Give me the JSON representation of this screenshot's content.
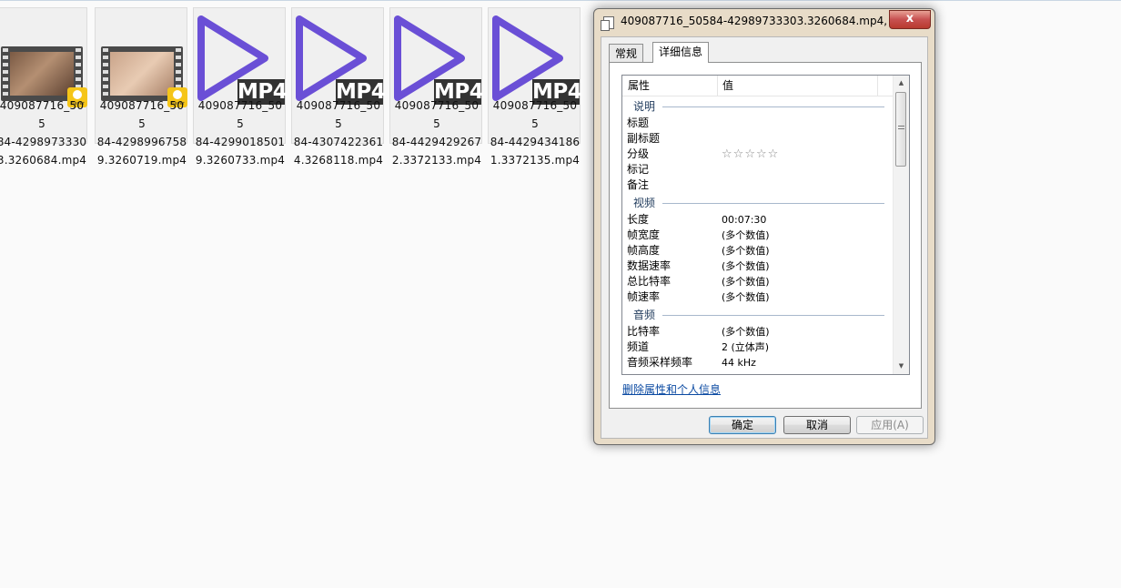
{
  "files": [
    {
      "name": "409087716_50584-42989733303.3260684.mp4",
      "line1": "409087716_505",
      "line2": "84-4298973330",
      "line3": "3.3260684.mp4",
      "thumb": "video-frame",
      "badge": "Player"
    },
    {
      "name": "409087716_50584-42989967589.3260719.mp4",
      "line1": "409087716_505",
      "line2": "84-4298996758",
      "line3": "9.3260719.mp4",
      "thumb": "video-frame",
      "badge": "Player"
    },
    {
      "name": "409087716_50584-42990185019.3260733.mp4",
      "line1": "409087716_505",
      "line2": "84-4299018501",
      "line3": "9.3260733.mp4",
      "thumb": "mp4-play-icon",
      "label": "MP4"
    },
    {
      "name": "409087716_50584-43074223614.3268118.mp4",
      "line1": "409087716_505",
      "line2": "84-4307422361",
      "line3": "4.3268118.mp4",
      "thumb": "mp4-play-icon",
      "label": "MP4"
    },
    {
      "name": "409087716_50584-44294292672.3372133.mp4",
      "line1": "409087716_505",
      "line2": "84-4429429267",
      "line3": "2.3372133.mp4",
      "thumb": "mp4-play-icon",
      "label": "MP4"
    },
    {
      "name": "409087716_50584-44294341861.3372135.mp4",
      "line1": "409087716_505",
      "line2": "84-4429434186",
      "line3": "1.3372135.mp4",
      "thumb": "mp4-play-icon",
      "label": "MP4"
    }
  ],
  "dialog": {
    "title": "409087716_50584-42989733303.3260684.mp4, ....",
    "close": "x",
    "tabs": [
      "常规",
      "详细信息"
    ],
    "active_tab": "详细信息",
    "columns": {
      "property": "属性",
      "value": "值"
    },
    "sections": [
      {
        "label": "说明",
        "rows": [
          {
            "k": "标题",
            "v": ""
          },
          {
            "k": "副标题",
            "v": ""
          },
          {
            "k": "分级",
            "v": "",
            "stars": 5
          },
          {
            "k": "标记",
            "v": ""
          },
          {
            "k": "备注",
            "v": ""
          }
        ]
      },
      {
        "label": "视频",
        "rows": [
          {
            "k": "长度",
            "v": "00:07:30"
          },
          {
            "k": "帧宽度",
            "v": "(多个数值)"
          },
          {
            "k": "帧高度",
            "v": "(多个数值)"
          },
          {
            "k": "数据速率",
            "v": "(多个数值)"
          },
          {
            "k": "总比特率",
            "v": "(多个数值)"
          },
          {
            "k": "帧速率",
            "v": "(多个数值)"
          }
        ]
      },
      {
        "label": "音频",
        "rows": [
          {
            "k": "比特率",
            "v": "(多个数值)"
          },
          {
            "k": "频道",
            "v": "2 (立体声)"
          },
          {
            "k": "音频采样频率",
            "v": "44 kHz"
          }
        ]
      }
    ],
    "remove_link": "删除属性和个人信息",
    "buttons": {
      "ok": "确定",
      "cancel": "取消",
      "apply": "应用(A)"
    },
    "accent": "#3c7fb1"
  }
}
